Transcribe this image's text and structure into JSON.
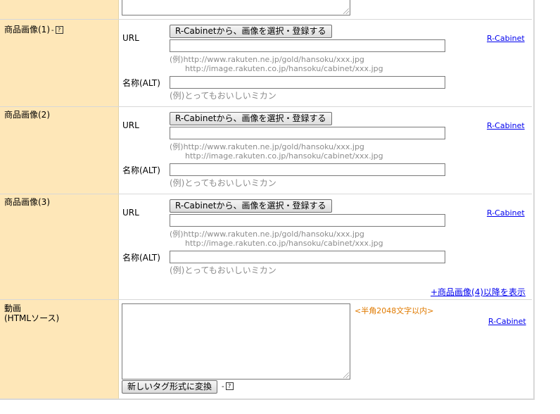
{
  "help_glyph": "?",
  "images": [
    {
      "label": "商品画像(1)",
      "has_help": true,
      "url_label": "URL",
      "button_label": "R-Cabinetから、画像を選択・登録する",
      "url_value": "",
      "example_line1": "(例)http://www.rakuten.ne.jp/gold/hansoku/xxx.jpg",
      "example_line2": "http://image.rakuten.co.jp/hansoku/cabinet/xxx.jpg",
      "alt_label": "名称(ALT)",
      "alt_value": "",
      "alt_example": "(例)とってもおいしいミカン",
      "link": "R-Cabinet"
    },
    {
      "label": "商品画像(2)",
      "has_help": false,
      "url_label": "URL",
      "button_label": "R-Cabinetから、画像を選択・登録する",
      "url_value": "",
      "example_line1": "(例)http://www.rakuten.ne.jp/gold/hansoku/xxx.jpg",
      "example_line2": "http://image.rakuten.co.jp/hansoku/cabinet/xxx.jpg",
      "alt_label": "名称(ALT)",
      "alt_value": "",
      "alt_example": "(例)とってもおいしいミカン",
      "link": "R-Cabinet"
    },
    {
      "label": "商品画像(3)",
      "has_help": false,
      "url_label": "URL",
      "button_label": "R-Cabinetから、画像を選択・登録する",
      "url_value": "",
      "example_line1": "(例)http://www.rakuten.ne.jp/gold/hansoku/xxx.jpg",
      "example_line2": "http://image.rakuten.co.jp/hansoku/cabinet/xxx.jpg",
      "alt_label": "名称(ALT)",
      "alt_value": "",
      "alt_example": "(例)とってもおいしいミカン",
      "link": "R-Cabinet"
    }
  ],
  "more_images_link": "+商品画像(4)以降を表示",
  "video": {
    "label_line1": "動画",
    "label_line2": "(HTMLソース)",
    "value": "",
    "limit_note": "<半角2048文字以内>",
    "link": "R-Cabinet",
    "convert_button": "新しいタグ形式に変換"
  },
  "colors": {
    "label_column_bg": "#fee7b8",
    "link": "#0000ee",
    "note": "#e07a00",
    "example_text": "#8c8c8c"
  }
}
